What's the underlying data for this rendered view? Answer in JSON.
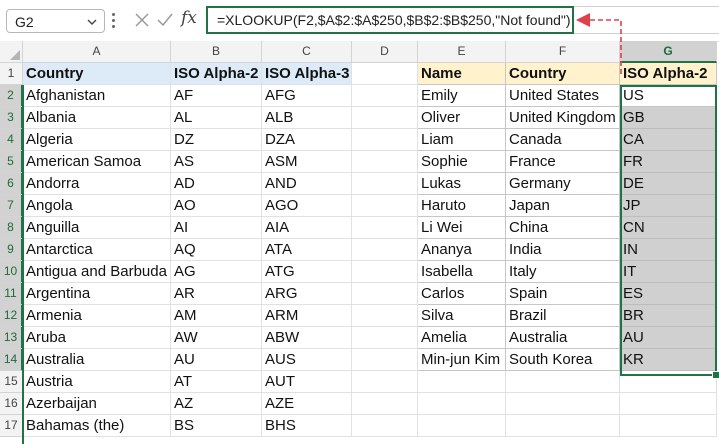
{
  "name_box": {
    "value": "G2"
  },
  "formula_bar": {
    "cancel_icon": "close-icon",
    "enter_icon": "check-icon",
    "fx_label": "fx",
    "formula": "=XLOOKUP(F2,$A$2:$A$250,$B$2:$B$250,\"Not found\")"
  },
  "columns": [
    "A",
    "B",
    "C",
    "D",
    "E",
    "F",
    "G"
  ],
  "selected_column": "G",
  "rows": [
    "1",
    "2",
    "3",
    "4",
    "5",
    "6",
    "7",
    "8",
    "9",
    "10",
    "11",
    "12",
    "13",
    "14",
    "15",
    "16",
    "17"
  ],
  "table1": {
    "headers": [
      "Country",
      "ISO Alpha-2",
      "ISO Alpha-3"
    ],
    "rows": [
      [
        "Afghanistan",
        "AF",
        "AFG"
      ],
      [
        "Albania",
        "AL",
        "ALB"
      ],
      [
        "Algeria",
        "DZ",
        "DZA"
      ],
      [
        "American Samoa",
        "AS",
        "ASM"
      ],
      [
        "Andorra",
        "AD",
        "AND"
      ],
      [
        "Angola",
        "AO",
        "AGO"
      ],
      [
        "Anguilla",
        "AI",
        "AIA"
      ],
      [
        "Antarctica",
        "AQ",
        "ATA"
      ],
      [
        "Antigua and Barbuda",
        "AG",
        "ATG"
      ],
      [
        "Argentina",
        "AR",
        "ARG"
      ],
      [
        "Armenia",
        "AM",
        "ARM"
      ],
      [
        "Aruba",
        "AW",
        "ABW"
      ],
      [
        "Australia",
        "AU",
        "AUS"
      ],
      [
        "Austria",
        "AT",
        "AUT"
      ],
      [
        "Azerbaijan",
        "AZ",
        "AZE"
      ],
      [
        "Bahamas (the)",
        "BS",
        "BHS"
      ]
    ]
  },
  "table2": {
    "headers": [
      "Name",
      "Country",
      "ISO Alpha-2"
    ],
    "rows": [
      [
        "Emily",
        "United States",
        "US"
      ],
      [
        "Oliver",
        "United Kingdom",
        "GB"
      ],
      [
        "Liam",
        "Canada",
        "CA"
      ],
      [
        "Sophie",
        "France",
        "FR"
      ],
      [
        "Lukas",
        "Germany",
        "DE"
      ],
      [
        "Haruto",
        "Japan",
        "JP"
      ],
      [
        "Li Wei",
        "China",
        "CN"
      ],
      [
        "Ananya",
        "India",
        "IN"
      ],
      [
        "Isabella",
        "Italy",
        "IT"
      ],
      [
        "Carlos",
        "Spain",
        "ES"
      ],
      [
        "Silva",
        "Brazil",
        "BR"
      ],
      [
        "Amelia",
        "Australia",
        "AU"
      ],
      [
        "Min-jun Kim",
        "South Korea",
        "KR"
      ]
    ]
  },
  "colors": {
    "accent_green": "#217346",
    "header_blue": "#dcebf7",
    "header_yellow": "#fff2cc",
    "selection_gray": "#d0d0d0",
    "annotation_red": "#e0404a"
  }
}
